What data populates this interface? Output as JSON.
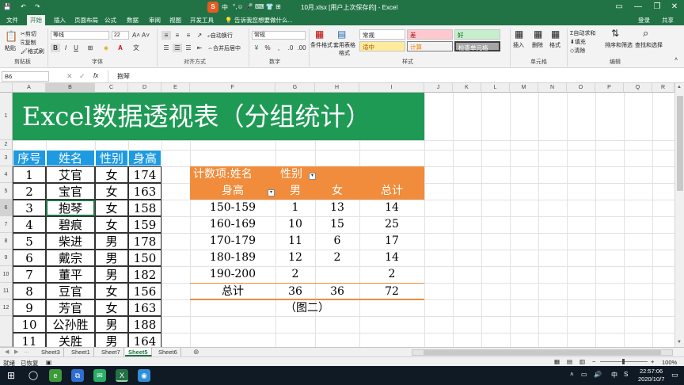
{
  "window": {
    "title": "10月.xlsx [用户上次保存的] - Excel",
    "login": "登录",
    "share": "共享",
    "minimize": "—",
    "restore": "❐",
    "close": "✕"
  },
  "tabs": [
    "文件",
    "开始",
    "插入",
    "页面布局",
    "公式",
    "数据",
    "审阅",
    "视图",
    "开发工具"
  ],
  "tell_me": "告诉我您想要做什么...",
  "ribbon": {
    "paste": "粘贴",
    "cut": "剪切",
    "copy": "复制",
    "format_painter": "格式刷",
    "font_name": "等线",
    "font_size": "22",
    "wrap": "自动换行",
    "merge": "合并后居中",
    "number_format": "常规",
    "cond_format": "条件格式",
    "table_format": "套用表格格式",
    "styles": {
      "normal": "常规",
      "bad": "差",
      "good": "好",
      "neutral": "适中",
      "calc": "计算",
      "check": "检查单元格"
    },
    "insert": "插入",
    "delete": "删除",
    "format": "格式",
    "autosum": "自动求和",
    "fill": "填充",
    "clear": "清除",
    "sort_filter": "排序和筛选",
    "find_select": "查找和选择",
    "groups": [
      "剪贴板",
      "字体",
      "对齐方式",
      "数字",
      "样式",
      "单元格",
      "编辑"
    ]
  },
  "formula_bar": {
    "cell_ref": "B6",
    "fx": "fx",
    "value": "抱琴"
  },
  "columns": [
    "A",
    "B",
    "C",
    "D",
    "E",
    "F",
    "G",
    "H",
    "I",
    "J",
    "K",
    "L",
    "M",
    "N",
    "O",
    "P",
    "Q",
    "R"
  ],
  "rows": [
    "1",
    "2",
    "3",
    "4",
    "5",
    "6",
    "7",
    "8",
    "9",
    "10",
    "11",
    "12"
  ],
  "banner": "Excel数据透视表（分组统计）",
  "table": {
    "headers": [
      "序号",
      "姓名",
      "性别",
      "身高"
    ],
    "rows": [
      [
        "1",
        "艾官",
        "女",
        "174"
      ],
      [
        "2",
        "宝官",
        "女",
        "163"
      ],
      [
        "3",
        "抱琴",
        "女",
        "158"
      ],
      [
        "4",
        "碧痕",
        "女",
        "159"
      ],
      [
        "5",
        "柴进",
        "男",
        "178"
      ],
      [
        "6",
        "戴宗",
        "男",
        "150"
      ],
      [
        "7",
        "董平",
        "男",
        "182"
      ],
      [
        "8",
        "豆官",
        "女",
        "156"
      ],
      [
        "9",
        "芳官",
        "女",
        "163"
      ],
      [
        "10",
        "公孙胜",
        "男",
        "188"
      ],
      [
        "11",
        "关胜",
        "男",
        "164"
      ]
    ]
  },
  "pivot": {
    "corner": "计数项:姓名",
    "col_field": "性别",
    "row_field": "身高",
    "col_headers": [
      "男",
      "女",
      "总计"
    ],
    "rows": [
      [
        "150-159",
        "1",
        "13",
        "14"
      ],
      [
        "160-169",
        "10",
        "15",
        "25"
      ],
      [
        "170-179",
        "11",
        "6",
        "17"
      ],
      [
        "180-189",
        "12",
        "2",
        "14"
      ],
      [
        "190-200",
        "2",
        "",
        "2"
      ]
    ],
    "total_label": "总计",
    "totals": [
      "36",
      "36",
      "72"
    ],
    "caption": "（图二）"
  },
  "sheet_tabs": [
    "Sheet3",
    "Sheet1",
    "Sheet7",
    "Sheet5",
    "Sheet6"
  ],
  "active_sheet": "Sheet5",
  "status": {
    "ready": "就绪",
    "recovered": "已恢复",
    "zoom": "100%"
  },
  "taskbar": {
    "time": "22:57:06",
    "date": "2020/10/7",
    "ime": "中"
  },
  "colors": {
    "excel_green": "#217346",
    "banner_green": "#1e9a55",
    "header_blue": "#1e9ae0",
    "pivot_orange": "#f08c3c"
  }
}
